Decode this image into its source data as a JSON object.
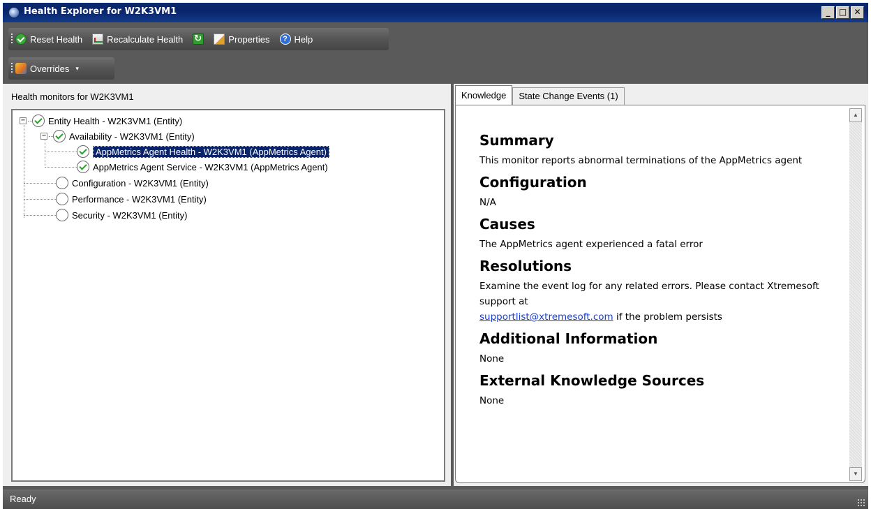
{
  "window": {
    "title": "Health Explorer for W2K3VM1",
    "controls": {
      "minimize": "_",
      "maximize": "□",
      "close": "✕"
    }
  },
  "toolbar": {
    "reset_health": "Reset Health",
    "recalculate_health": "Recalculate Health",
    "properties": "Properties",
    "help": "Help",
    "overrides": "Overrides",
    "overrides_caret": "▾",
    "icons": [
      "check-circle-icon",
      "recalculate-icon",
      "refresh-icon",
      "properties-icon",
      "help-icon",
      "overrides-icon"
    ]
  },
  "left_pane": {
    "header": "Health monitors for W2K3VM1",
    "tree": {
      "root": {
        "label": "Entity Health - W2K3VM1 (Entity)",
        "state": "healthy",
        "expanded": true
      },
      "availability": {
        "label": "Availability - W2K3VM1 (Entity)",
        "state": "healthy",
        "expanded": true
      },
      "agent_health": {
        "label": "AppMetrics Agent Health - W2K3VM1 (AppMetrics Agent)",
        "state": "healthy",
        "selected": true
      },
      "agent_service": {
        "label": "AppMetrics Agent Service - W2K3VM1 (AppMetrics Agent)",
        "state": "healthy"
      },
      "configuration": {
        "label": "Configuration - W2K3VM1 (Entity)",
        "state": "not-monitored"
      },
      "performance": {
        "label": "Performance - W2K3VM1 (Entity)",
        "state": "not-monitored"
      },
      "security": {
        "label": "Security - W2K3VM1 (Entity)",
        "state": "not-monitored"
      }
    }
  },
  "right_pane": {
    "tabs": [
      {
        "label": "Knowledge",
        "active": true
      },
      {
        "label": "State Change Events (1)",
        "active": false
      }
    ],
    "knowledge": {
      "summary_heading": "Summary",
      "summary_text": "This monitor reports abnormal terminations of the AppMetrics agent",
      "configuration_heading": "Configuration",
      "configuration_text": "N/A",
      "causes_heading": "Causes",
      "causes_text": "The AppMetrics agent experienced a fatal error",
      "resolutions_heading": "Resolutions",
      "resolutions_text": "Examine the event log for any related errors. Please contact Xtremesoft support at",
      "resolutions_link": "supportlist@xtremesoft.com",
      "resolutions_tail": " if the problem persists",
      "additional_heading": "Additional Information",
      "additional_text": "None",
      "external_heading": "External Knowledge Sources",
      "external_text": "None"
    }
  },
  "status": {
    "text": "Ready"
  }
}
